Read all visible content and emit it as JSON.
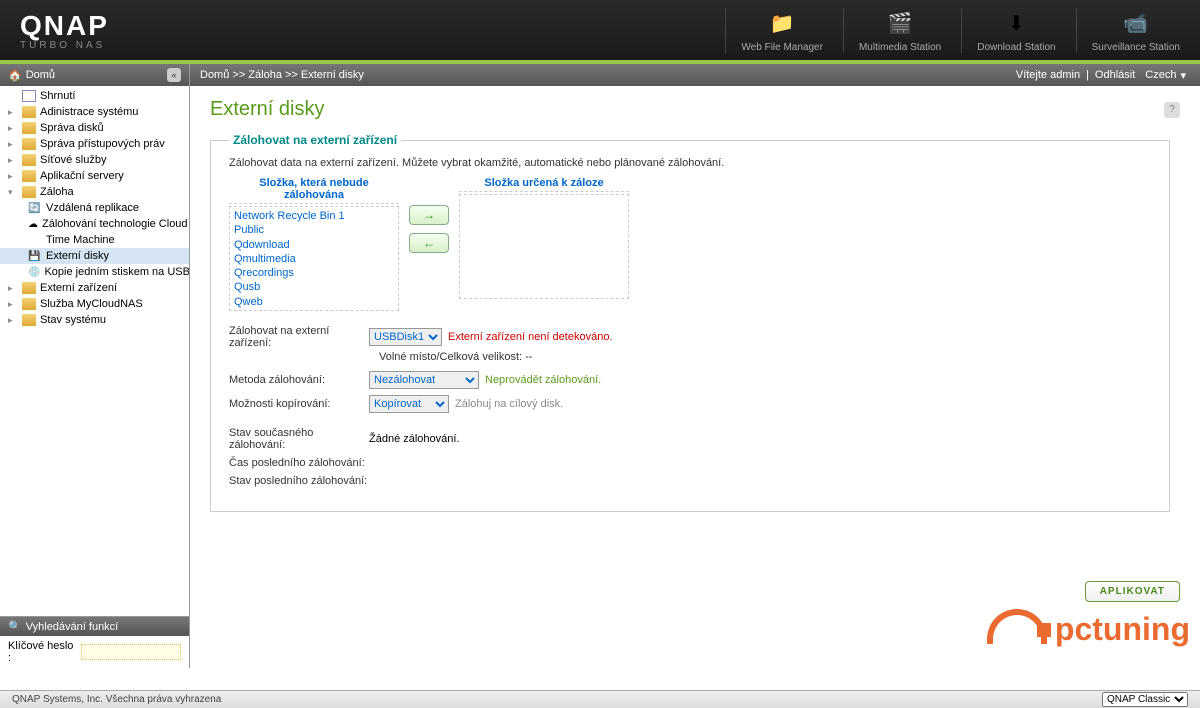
{
  "brand": {
    "name": "QNAP",
    "sub": "TURBO NAS"
  },
  "headerIcons": [
    {
      "label": "Web File Manager",
      "icon": "📁"
    },
    {
      "label": "Multimedia Station",
      "icon": "🎬"
    },
    {
      "label": "Download Station",
      "icon": "⬇"
    },
    {
      "label": "Surveillance Station",
      "icon": "📹"
    }
  ],
  "topbar": {
    "home": "Domů"
  },
  "contentBar": {
    "breadcrumb": "Domů >> Záloha >> Externí disky",
    "welcome": "Vítejte admin",
    "logout": "Odhlásit",
    "lang": "Czech"
  },
  "tree": {
    "items": [
      {
        "label": "Shrnutí",
        "type": "doc"
      },
      {
        "label": "Adinistrace systému",
        "type": "folder",
        "arrow": "▸"
      },
      {
        "label": "Správa disků",
        "type": "folder",
        "arrow": "▸"
      },
      {
        "label": "Správa přístupových práv",
        "type": "folder",
        "arrow": "▸"
      },
      {
        "label": "Síťové služby",
        "type": "folder",
        "arrow": "▸"
      },
      {
        "label": "Aplikační servery",
        "type": "folder",
        "arrow": "▸"
      },
      {
        "label": "Záloha",
        "type": "folder",
        "arrow": "▾",
        "open": true
      },
      {
        "label": "Externí zařízení",
        "type": "folder",
        "arrow": "▸"
      },
      {
        "label": "Služba MyCloudNAS",
        "type": "folder",
        "arrow": "▸"
      },
      {
        "label": "Stav systému",
        "type": "folder",
        "arrow": "▸"
      }
    ],
    "backupChildren": [
      {
        "label": "Vzdálená replikace",
        "icon": "🔄"
      },
      {
        "label": "Zálohování technologie Cloud",
        "icon": "☁"
      },
      {
        "label": "Time Machine",
        "icon": "apple"
      },
      {
        "label": "Externí disky",
        "icon": "💾",
        "active": true
      },
      {
        "label": "Kopie jedním stiskem na USB",
        "icon": "💿"
      }
    ]
  },
  "search": {
    "title": "Vyhledávání funkcí",
    "label": "Klíčové heslo :"
  },
  "page": {
    "title": "Externí disky",
    "fieldsetLegend": "Zálohovat na externí zařízení",
    "desc": "Zálohovat data na externí zařízení. Můžete vybrat okamžité, automatické nebo plánované zálohování.",
    "sourceHead": "Složka, která nebude zálohována",
    "targetHead": "Složka určená k záloze",
    "sourceItems": [
      "Network Recycle Bin 1",
      "Public",
      "Qdownload",
      "Qmultimedia",
      "Qrecordings",
      "Qusb",
      "Qweb"
    ],
    "rows": {
      "destLabel": "Zálohovat na externí zařízení:",
      "destValue": "USBDisk1",
      "destWarn": "Externí zařízení není detekováno.",
      "destSub": "Volné místo/Celková velikost: --",
      "methodLabel": "Metoda zálohování:",
      "methodValue": "Nezálohovat",
      "methodNote": "Neprovádět zálohování.",
      "copyLabel": "Možnosti kopírování:",
      "copyValue": "Kopírovat",
      "copyNote": "Zálohuj na cílový disk.",
      "statusLabel": "Stav současného zálohování:",
      "statusValue": "Žádné zálohování.",
      "lastTimeLabel": "Čas posledního zálohování:",
      "lastStateLabel": "Stav posledního zálohování:"
    },
    "applyBtn": "APLIKOVAT"
  },
  "footer": {
    "copyright": "QNAP Systems, Inc. Všechna práva vyhrazena",
    "theme": "QNAP Classic"
  },
  "watermark": "pctuning"
}
